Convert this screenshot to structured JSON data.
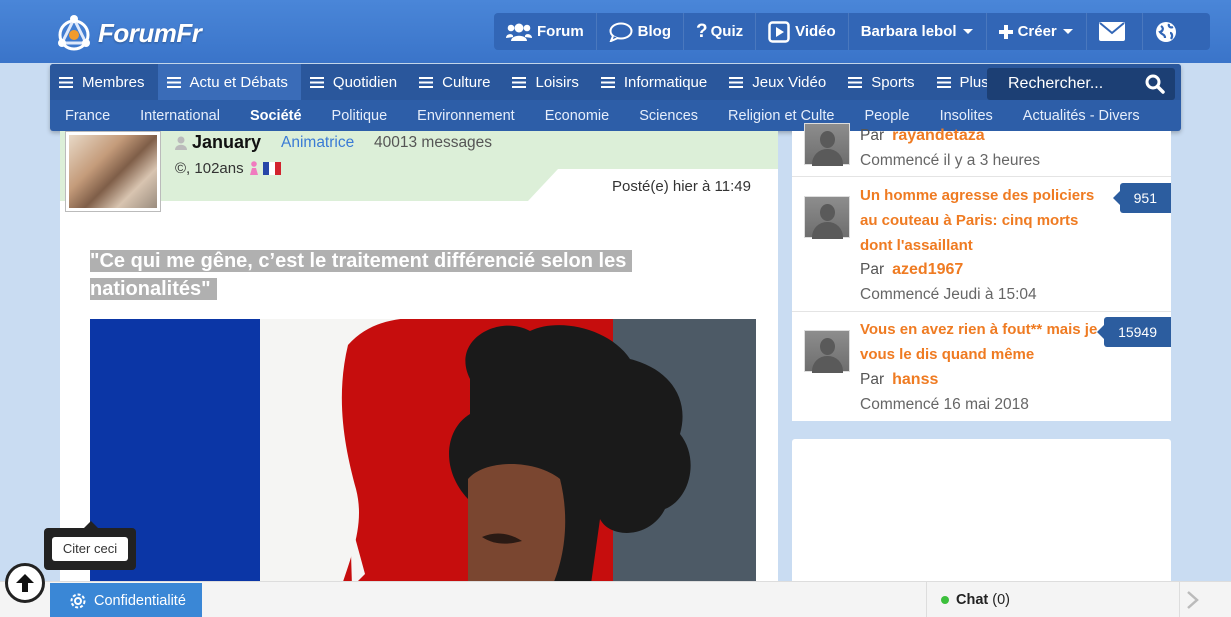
{
  "header": {
    "logo_text": "ForumFr",
    "nav": [
      {
        "label": "Forum",
        "icon": "users-icon"
      },
      {
        "label": "Blog",
        "icon": "speech-bubble-icon"
      },
      {
        "label": "Quiz",
        "icon": "question-icon"
      },
      {
        "label": "Vidéo",
        "icon": "play-icon"
      },
      {
        "label": "Barbara lebol",
        "icon": "chevron-down-icon"
      },
      {
        "label": "Créer",
        "icon": "plus-icon"
      }
    ]
  },
  "categories": {
    "items": [
      "Membres",
      "Actu et Débats",
      "Quotidien",
      "Culture",
      "Loisirs",
      "Informatique",
      "Jeux Vidéo",
      "Sports",
      "Plus"
    ],
    "active": "Actu et Débats",
    "search_placeholder": "Rechercher...",
    "sub_items": [
      "France",
      "International",
      "Société",
      "Politique",
      "Environnement",
      "Economie",
      "Sciences",
      "Religion et Culte",
      "People",
      "Insolites",
      "Actualités - Divers"
    ],
    "active_sub": "Société"
  },
  "post": {
    "username": "January",
    "role": "Animatrice",
    "messages": "40013 messages",
    "age": "©, 102ans",
    "posted": "Posté(e) hier à 11:49",
    "title": "\"Ce qui me gêne, c’est le traitement différencié selon les nationalités\""
  },
  "sidebar": {
    "topics": [
      {
        "title": "",
        "by_label": "Par",
        "author": "rayandetaza",
        "date": "Commencé il y a 3 heures",
        "count": ""
      },
      {
        "title": "Un homme agresse des policiers au couteau à Paris: cinq morts dont l'assaillant",
        "by_label": "Par",
        "author": "azed1967",
        "date": "Commencé Jeudi à 15:04",
        "count": "951"
      },
      {
        "title": "Vous en avez rien à fout** mais je vous le dis quand même",
        "by_label": "Par",
        "author": "hanss",
        "date": "Commencé 16 mai 2018",
        "count": "15949"
      }
    ]
  },
  "footer": {
    "privacy_label": "Confidentialité",
    "chat_label": "Chat",
    "chat_count": "(0)",
    "tooltip": "Citer ceci"
  },
  "colors": {
    "brand_blue": "#3a74c9",
    "accent_orange": "#ef7b22",
    "badge_blue": "#2c5d9f"
  }
}
